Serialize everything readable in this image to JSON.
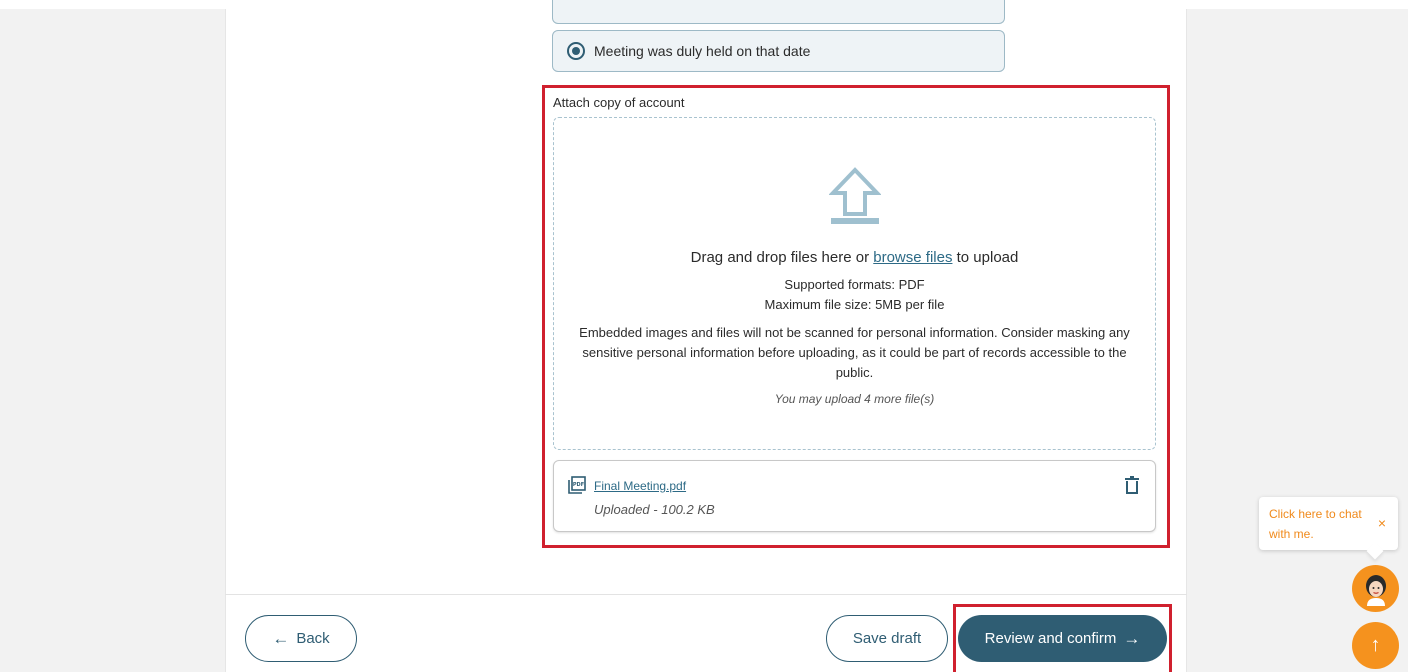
{
  "form": {
    "radio_option_label": "Meeting was duly held on that date",
    "attach_label": "Attach copy of account"
  },
  "dropzone": {
    "main_before": "Drag and drop files here or ",
    "browse_link": "browse files",
    "main_after": " to upload",
    "formats": "Supported formats: PDF",
    "max_size": "Maximum file size: 5MB per file",
    "warning": "Embedded images and files will not be scanned for personal information. Consider masking any sensitive personal information before uploading, as it could be part of records accessible to the public.",
    "remaining": "You may upload 4 more file(s)"
  },
  "uploaded_file": {
    "name": "Final Meeting.pdf",
    "status": "Uploaded - 100.2 KB"
  },
  "footer": {
    "back_label": "Back",
    "save_label": "Save draft",
    "review_label": "Review and confirm"
  },
  "chat": {
    "prompt": "Click here to chat with me.",
    "close_symbol": "×"
  },
  "colors": {
    "primary": "#2f5d73",
    "highlight": "#d0202e",
    "accent_orange": "#f5921e",
    "link": "#2d6a86"
  },
  "icons": {
    "upload": "upload-arrow-icon",
    "pdf": "pdf-file-icon",
    "delete": "trash-icon",
    "back": "arrow-left-icon",
    "next": "arrow-right-icon",
    "scroll_top": "arrow-up-icon"
  }
}
